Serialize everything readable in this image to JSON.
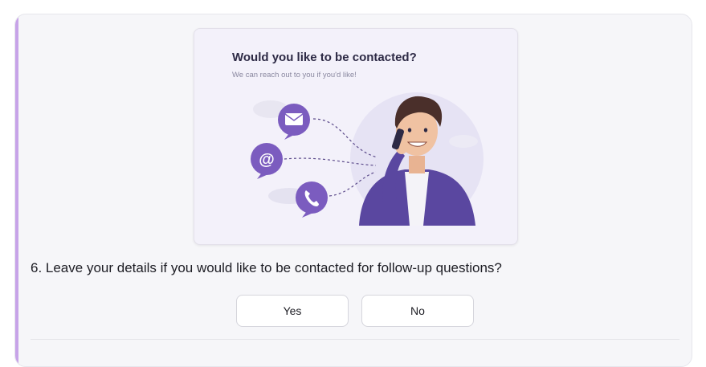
{
  "illustration": {
    "title": "Would you like to be contacted?",
    "subtitle": "We can reach out to you if you'd like!",
    "icons": [
      "envelope-icon",
      "at-sign-icon",
      "phone-icon"
    ],
    "figure": "person-on-phone"
  },
  "question": {
    "number": "6.",
    "text": "6. Leave your details if you would like to be contacted for follow-up questions?"
  },
  "options": {
    "yes_label": "Yes",
    "no_label": "No"
  },
  "colors": {
    "accent": "#c7a3e8",
    "icon_purple": "#7b5cbf",
    "card_background": "#f6f6f9"
  }
}
